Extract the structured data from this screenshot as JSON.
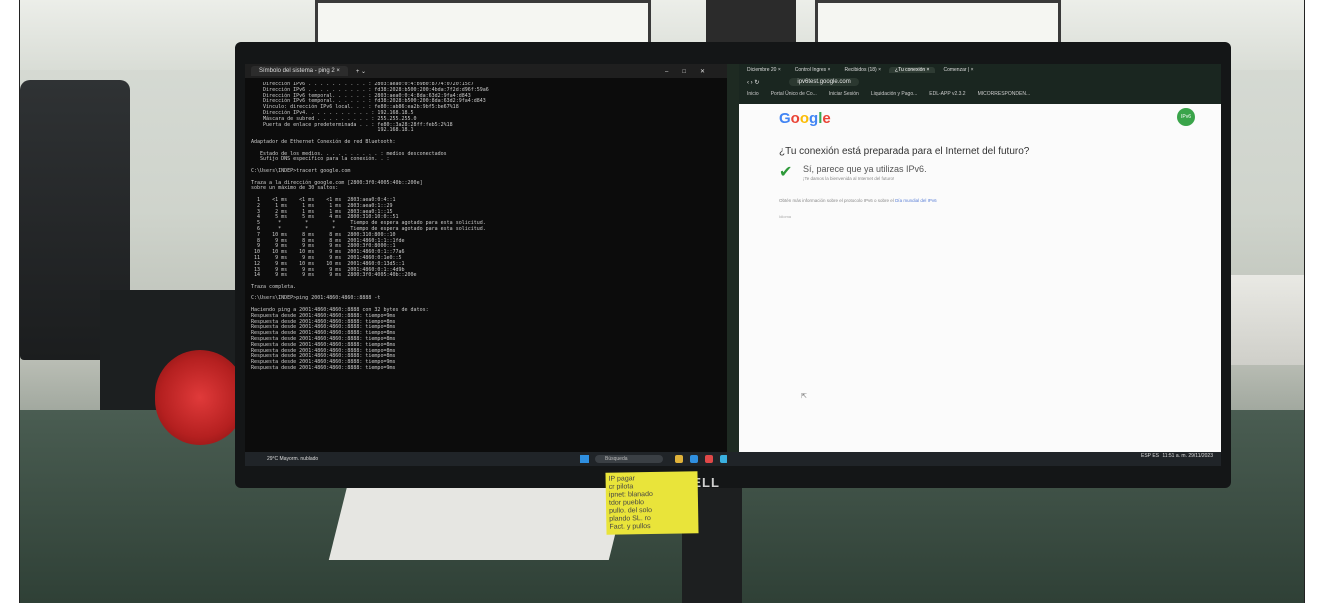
{
  "terminal": {
    "tab_label": "Símbolo del sistema - ping 2 ×",
    "lines": [
      "    Dirección IPv6 . . . . . . . . . . : 2803:aea0:0:4:b9b0:8774:0720:15c7",
      "    Dirección IPv6 . . . . . . . . . . : fd38:2028:b500:200:4bda:7f2d:d96f:59a6",
      "    Dirección IPv6 temporal. . . . . . : 2803:aea0:0:4:8da:63d2:9fa4:d843",
      "    Dirección IPv6 temporal. . . . . . : fd38:2028:b500:200:8da:63d2:9fa4:d843",
      "    Vínculo: dirección IPv6 local. . . : fe80::ab86:ea2b:9bf5:be67%18",
      "    Dirección IPv4. . . . . . . . . . . : 192.168.18.5",
      "    Máscara de subred . . . . . . . . . : 255.255.255.0",
      "    Puerta de enlace predeterminada . . : fe80::3a28:28ff:feb5:2%18",
      "                                          192.168.18.1",
      "",
      "Adaptador de Ethernet Conexión de red Bluetooth:",
      "",
      "   Estado de los medios. . . . . . . . . . : medios desconectados",
      "   Sufijo DNS específico para la conexión. . :",
      "",
      "C:\\Users\\INDEP>tracert google.com",
      "",
      "Traza a la dirección google.com [2800:3f0:4005:40b::200e]",
      "sobre un máximo de 30 saltos:",
      "",
      "  1    <1 ms    <1 ms    <1 ms  2803:aea0:0:4::1",
      "  2     1 ms     1 ms     1 ms  2803:aea0:1::29",
      "  3     2 ms     1 ms     1 ms  2803:aea0:1::15",
      "  4     5 ms     5 ms     4 ms  2800:310:10:0::51",
      "  5      *        *        *     Tiempo de espera agotado para esta solicitud.",
      "  6      *        *        *     Tiempo de espera agotado para esta solicitud.",
      "  7    10 ms     8 ms     8 ms  2800:310:800::10",
      "  8     9 ms     8 ms     8 ms  2001:4860:1:1::1fde",
      "  9     9 ms     9 ms     9 ms  2800:3f0:8000::1",
      " 10    10 ms    10 ms     9 ms  2001:4860:0:1::77a6",
      " 11     9 ms     9 ms     9 ms  2001:4860:0:1e0::5",
      " 12     9 ms    10 ms    10 ms  2001:4860:0:13d5::1",
      " 13     9 ms     9 ms     9 ms  2001:4860:0:1::4d9b",
      " 14     9 ms     9 ms     9 ms  2800:3f0:4005:40b::200e",
      "",
      "Traza completa.",
      "",
      "C:\\Users\\INDEP>ping 2001:4860:4860::8888 -t",
      "",
      "Haciendo ping a 2001:4860:4860::8888 con 32 bytes de datos:",
      "Respuesta desde 2001:4860:4860::8888: tiempo=9ms",
      "Respuesta desde 2001:4860:4860::8888: tiempo=8ms",
      "Respuesta desde 2001:4860:4860::8888: tiempo=8ms",
      "Respuesta desde 2001:4860:4860::8888: tiempo=8ms",
      "Respuesta desde 2001:4860:4860::8888: tiempo=8ms",
      "Respuesta desde 2001:4860:4860::8888: tiempo=8ms",
      "Respuesta desde 2001:4860:4860::8888: tiempo=8ms",
      "Respuesta desde 2001:4860:4860::8888: tiempo=8ms",
      "Respuesta desde 2001:4860:4860::8888: tiempo=9ms",
      "Respuesta desde 2001:4860:4860::8888: tiempo=9ms"
    ]
  },
  "taskbar": {
    "weather": "29°C  Mayorm. nublado",
    "search": "Búsqueda",
    "lang": "ESP\nES",
    "clock": "11:51 a. m.\n29/11/2023"
  },
  "browser": {
    "tabs": [
      "Diciembre 20 ×",
      "Control Ingres ×",
      "Recibidos (18) ×",
      "¿Tu conexión ×",
      "Comenzar | ×"
    ],
    "url": "ipv6test.google.com",
    "bookmarks": [
      "Inicio",
      "Portal Único de Co...",
      "Iniciar Sesión",
      "Liquidación y Pago...",
      "EDL-APP v2.3.2",
      "MICORRESPONDEN..."
    ],
    "logo": "Google",
    "badge": "IPv6",
    "question": "¿Tu conexión está preparada para el Internet del futuro?",
    "answer": "Sí, parece que ya utilizas IPv6.",
    "answer_sub": "¡Te damos la bienvenida al Internet del futuro!",
    "more_info": "Obtén más información sobre el protocolo IPv6 o sobre el ",
    "more_link": "Día mundial del IPv6",
    "language": "Idioma"
  },
  "monitor": {
    "brand": "DELL"
  },
  "sticky_note": {
    "text": "IP pagar\ncr pilota\nipnet: blanado\ntdor pueblo\npullo. del solo\nplando SL. ro\nFact. y pullos"
  },
  "colors": {
    "google_blue": "#4285F4",
    "google_red": "#EA4335",
    "google_yellow": "#FBBC05",
    "google_green": "#34A853",
    "check_green": "#2e9a3a"
  }
}
